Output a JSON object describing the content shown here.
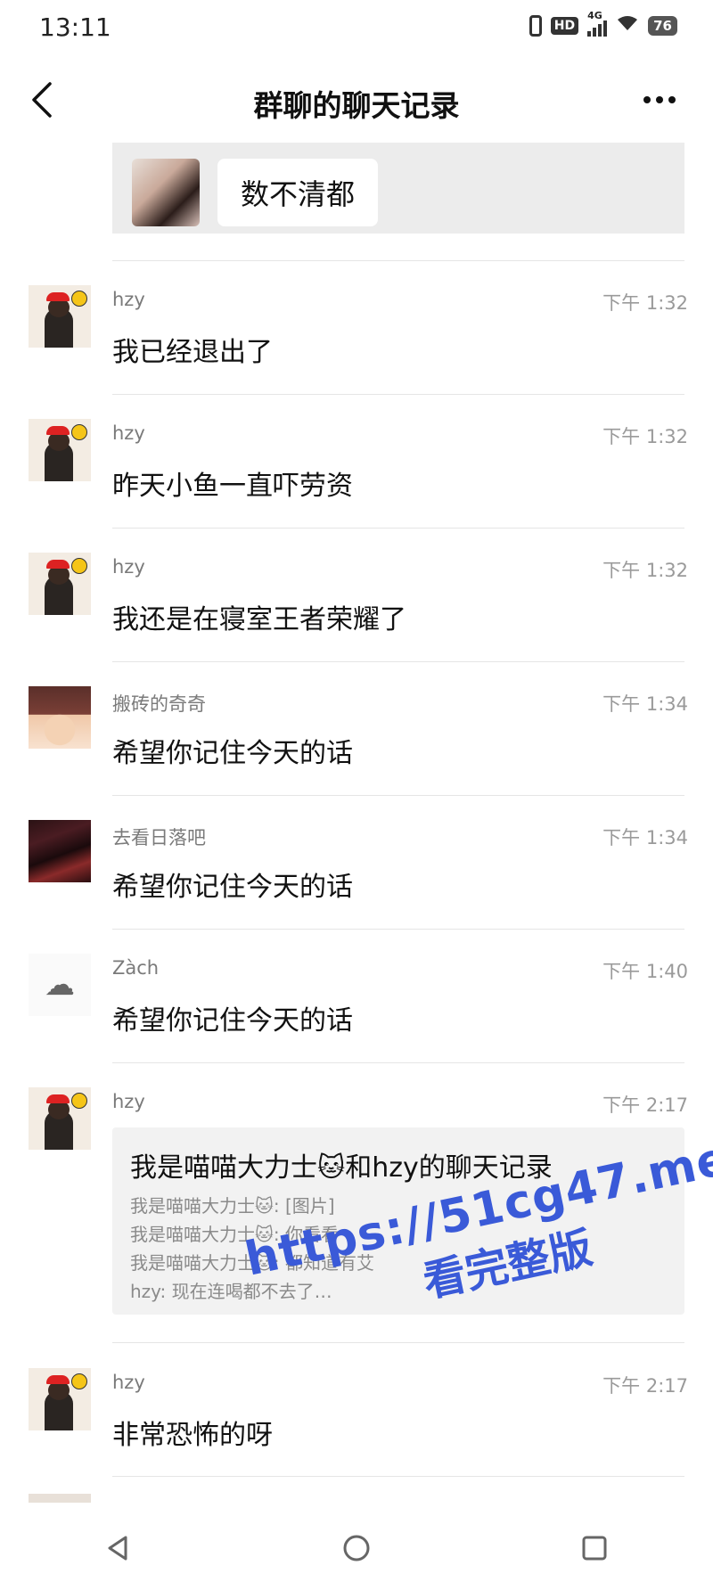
{
  "status_bar": {
    "time": "13:11",
    "hd": "HD",
    "network": "4G",
    "battery": "76"
  },
  "header": {
    "title": "群聊的聊天记录",
    "back_icon": "chevron-left-icon",
    "more_icon": "more-horizontal-icon"
  },
  "quote": {
    "text": "数不清都"
  },
  "messages": [
    {
      "name": "hzy",
      "time": "下午 1:32",
      "text": "我已经退出了",
      "avatar": "hzy"
    },
    {
      "name": "hzy",
      "time": "下午 1:32",
      "text": "昨天小鱼一直吓劳资",
      "avatar": "hzy"
    },
    {
      "name": "hzy",
      "time": "下午 1:32",
      "text": "我还是在寝室王者荣耀了",
      "avatar": "hzy"
    },
    {
      "name": "搬砖的奇奇",
      "time": "下午 1:34",
      "text": "希望你记住今天的话",
      "avatar": "qq"
    },
    {
      "name": "去看日落吧",
      "time": "下午 1:34",
      "text": "希望你记住今天的话",
      "avatar": "ql"
    },
    {
      "name": "Zàch",
      "time": "下午 1:40",
      "text": "希望你记住今天的话",
      "avatar": "zach"
    }
  ],
  "record_message": {
    "name": "hzy",
    "time": "下午 2:17",
    "title": "我是喵喵大力士🐱和hzy的聊天记录",
    "lines": [
      "我是喵喵大力士🐱: [图片]",
      "我是喵喵大力士🐱: 你看看",
      "我是喵喵大力士🐱: 都知道有艾",
      "hzy: 现在连喝都不去了…"
    ]
  },
  "last_message": {
    "name": "hzy",
    "time": "下午 2:17",
    "text": "非常恐怖的呀"
  },
  "watermark": {
    "line1": "https://51cg47.me",
    "line2": "看完整版"
  },
  "nav": {
    "back_icon": "triangle-back-icon",
    "home_icon": "circle-home-icon",
    "recents_icon": "square-recents-icon"
  }
}
